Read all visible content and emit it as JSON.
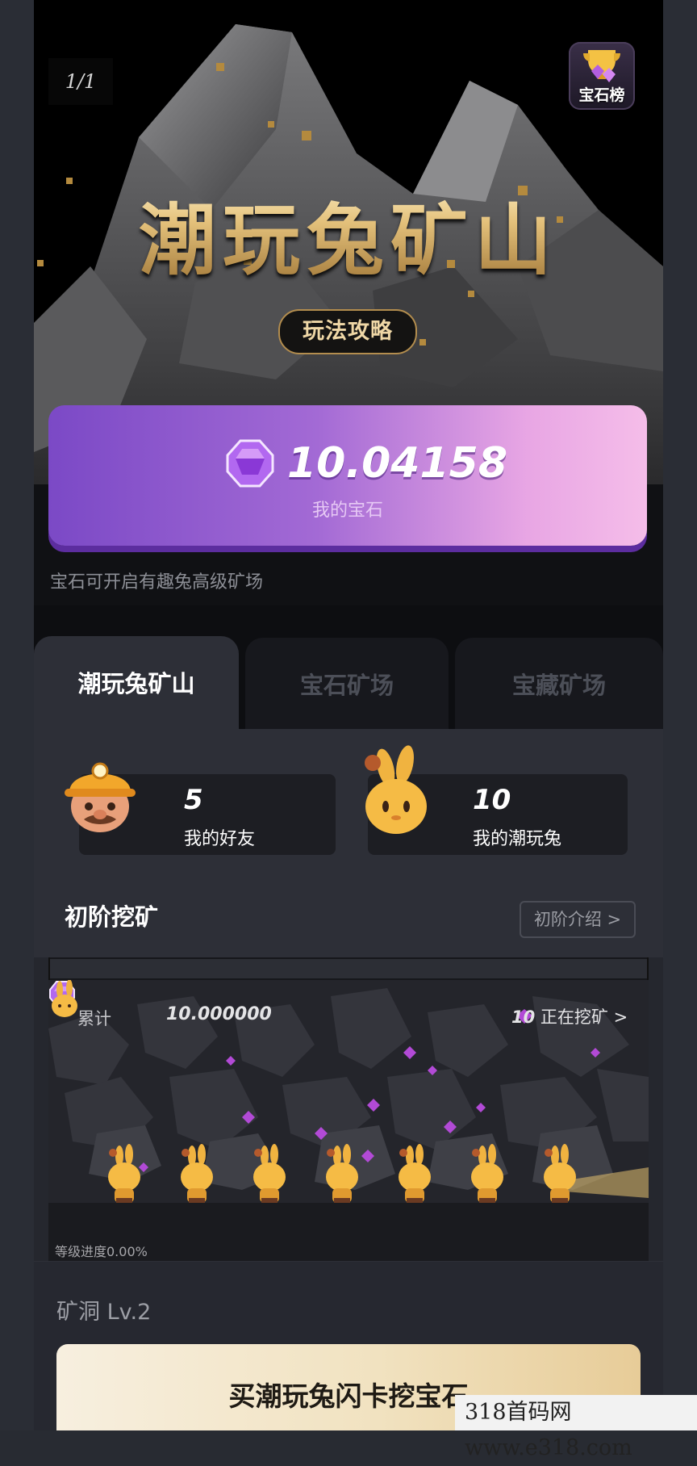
{
  "hero": {
    "page_indicator": "1/1",
    "rank_badge_label": "宝石榜",
    "title": "潮玩兔矿山",
    "guide_button": "玩法攻略"
  },
  "gems": {
    "value": "10.04158",
    "label": "我的宝石",
    "hint": "宝石可开启有趣兔高级矿场"
  },
  "tabs": [
    {
      "label": "潮玩兔矿山",
      "active": true
    },
    {
      "label": "宝石矿场",
      "active": false
    },
    {
      "label": "宝藏矿场",
      "active": false
    }
  ],
  "stats": {
    "friends": {
      "value": "5",
      "label": "我的好友"
    },
    "rabbits": {
      "value": "10",
      "label": "我的潮玩兔"
    }
  },
  "mining": {
    "section_title": "初阶挖矿",
    "intro_button": "初阶介绍 >",
    "total_label": "累计",
    "total_value": "10.000000",
    "mining_count": "10",
    "mining_text": "正在挖矿 >",
    "progress_text": "等级进度0.00%",
    "progress": 0.0
  },
  "cave": {
    "level": "矿洞 Lv.2",
    "buy_card": "买潮玩兔闪卡挖宝石"
  },
  "watermark": "318首码网 www.e318.com",
  "colors": {
    "gold": "#d7b46e",
    "gem_purple": "#a36ad5",
    "gem_pink": "#f5bde9",
    "panel": "#2d2f37"
  }
}
